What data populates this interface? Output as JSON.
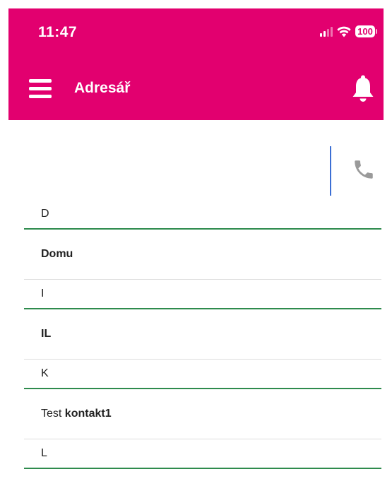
{
  "status_bar": {
    "time": "11:47",
    "battery": "100"
  },
  "app_bar": {
    "title": "Adresář",
    "menu_icon": "hamburger-menu-icon",
    "notification_icon": "bell-icon"
  },
  "search": {
    "value": "",
    "placeholder": "",
    "call_icon": "phone-icon"
  },
  "contacts": {
    "groups": [
      {
        "letter": "D",
        "name_regular": "",
        "name_bold": "Domu"
      },
      {
        "letter": "I",
        "name_regular": "",
        "name_bold": "IL"
      },
      {
        "letter": "K",
        "name_regular": "Test",
        "name_bold": "kontakt1"
      },
      {
        "letter": "L",
        "name_regular": "",
        "name_bold": ""
      }
    ]
  },
  "colors": {
    "header_bg": "#e2006f",
    "section_divider": "#2e8b4d",
    "caret": "#3b6fd4",
    "icon_gray": "#9a9a9a"
  }
}
